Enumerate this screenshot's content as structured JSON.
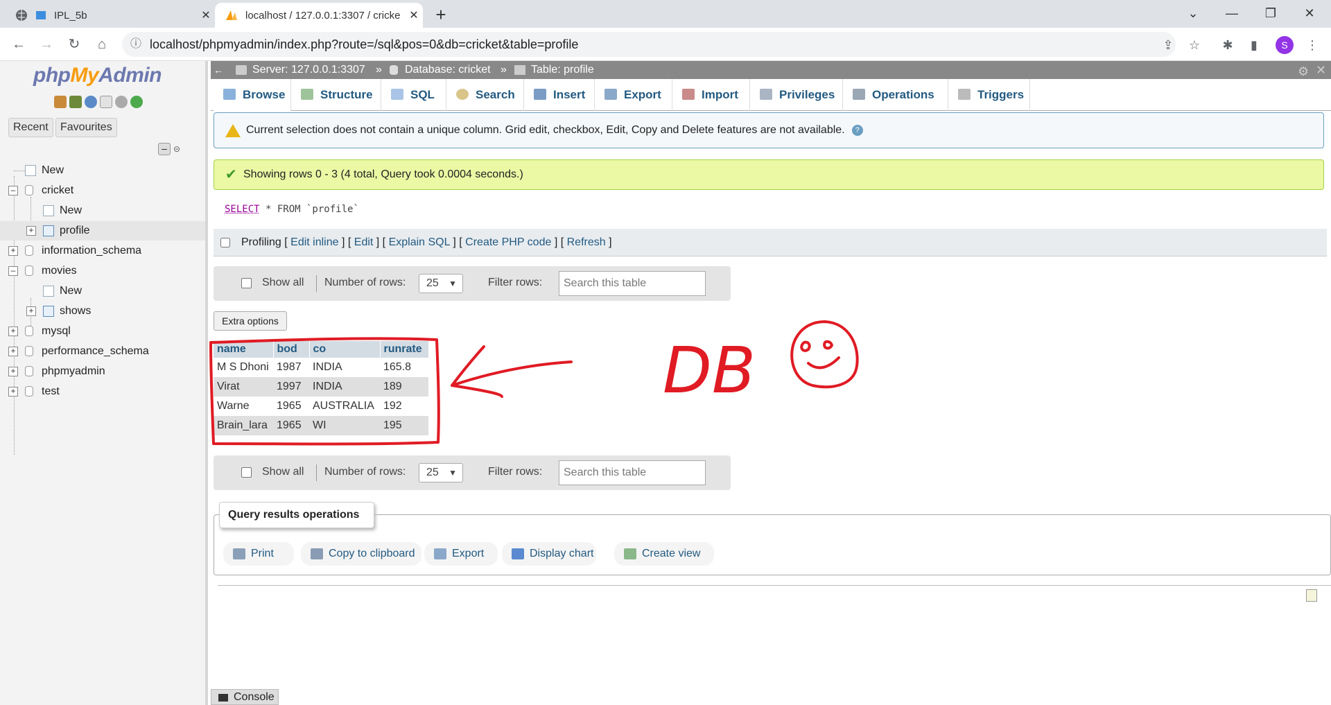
{
  "browser": {
    "tabs": [
      {
        "title": "IPL_5b",
        "active": false
      },
      {
        "title": "localhost / 127.0.0.1:3307 / cricke",
        "active": true
      }
    ],
    "url": "localhost/phpmyadmin/index.php?route=/sql&pos=0&db=cricket&table=profile",
    "profile_initial": "S"
  },
  "navigation": {
    "logo": {
      "php": "php",
      "my": "My",
      "admin": "Admin"
    },
    "tabs": [
      "Recent",
      "Favourites"
    ],
    "tree": [
      {
        "label": "New"
      },
      {
        "label": "cricket"
      },
      {
        "label": "New"
      },
      {
        "label": "profile"
      },
      {
        "label": "information_schema"
      },
      {
        "label": "movies"
      },
      {
        "label": "New"
      },
      {
        "label": "shows"
      },
      {
        "label": "mysql"
      },
      {
        "label": "performance_schema"
      },
      {
        "label": "phpmyadmin"
      },
      {
        "label": "test"
      }
    ]
  },
  "breadcrumb": {
    "server": "Server: 127.0.0.1:3307",
    "database": "Database: cricket",
    "table": "Table: profile",
    "sep": "»"
  },
  "tabs": [
    "Browse",
    "Structure",
    "SQL",
    "Search",
    "Insert",
    "Export",
    "Import",
    "Privileges",
    "Operations",
    "Triggers"
  ],
  "warning": "Current selection does not contain a unique column. Grid edit, checkbox, Edit, Copy and Delete features are not available.",
  "success": "Showing rows 0 - 3 (4 total, Query took 0.0004 seconds.)",
  "sql": {
    "select": "SELECT",
    "rest": " * FROM `profile`"
  },
  "profiling": {
    "label": "Profiling",
    "links": [
      "Edit inline",
      "Edit",
      "Explain SQL",
      "Create PHP code",
      "Refresh"
    ]
  },
  "table_nav": {
    "show_all": "Show all",
    "number_of_rows_label": "Number of rows:",
    "number_of_rows_value": "25",
    "filter_label": "Filter rows:",
    "filter_placeholder": "Search this table"
  },
  "extra_options": "Extra options",
  "results": {
    "columns": [
      "name",
      "bod",
      "co",
      "runrate"
    ],
    "rows": [
      [
        "M S Dhoni",
        "1987",
        "INDIA",
        "165.8"
      ],
      [
        "Virat",
        "1997",
        "INDIA",
        "189"
      ],
      [
        "Warne",
        "1965",
        "AUSTRALIA",
        "192"
      ],
      [
        "Brain_lara",
        "1965",
        "WI",
        "195"
      ]
    ]
  },
  "query_ops": {
    "legend": "Query results operations",
    "buttons": [
      "Print",
      "Copy to clipboard",
      "Export",
      "Display chart",
      "Create view"
    ]
  },
  "console": "Console",
  "annotation": {
    "text": "DB",
    "color": "#e01b24"
  }
}
